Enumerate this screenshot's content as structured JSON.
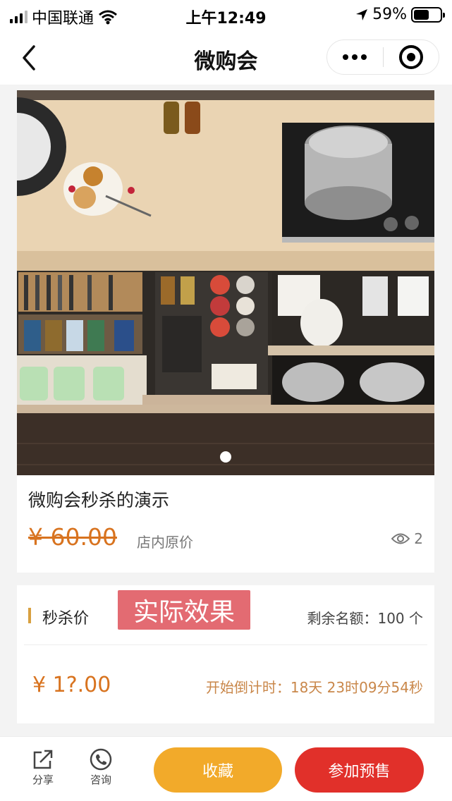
{
  "status_bar": {
    "carrier": "中国联通",
    "time": "上午12:49",
    "battery_percent": "59%",
    "battery_level": 0.59
  },
  "nav": {
    "title": "微购会"
  },
  "product": {
    "title": "微购会秒杀的演示",
    "original_price": "¥ 60.00",
    "original_price_label": "店内原价",
    "view_count": "2",
    "carousel_dots": 1
  },
  "flash_sale": {
    "label": "秒杀价",
    "effect_badge": "实际效果",
    "quota": "剩余名额：100 个",
    "price": "¥  1?.00",
    "countdown": "开始倒计时：18天 23时09分54秒"
  },
  "bottom_bar": {
    "share_label": "分享",
    "consult_label": "咨询",
    "favorite_label": "收藏",
    "presale_label": "参加预售"
  },
  "colors": {
    "accent_orange": "#d8731f",
    "favorite_button": "#f2aa2a",
    "presale_button": "#e1302a",
    "effect_badge": "#e36b72"
  }
}
